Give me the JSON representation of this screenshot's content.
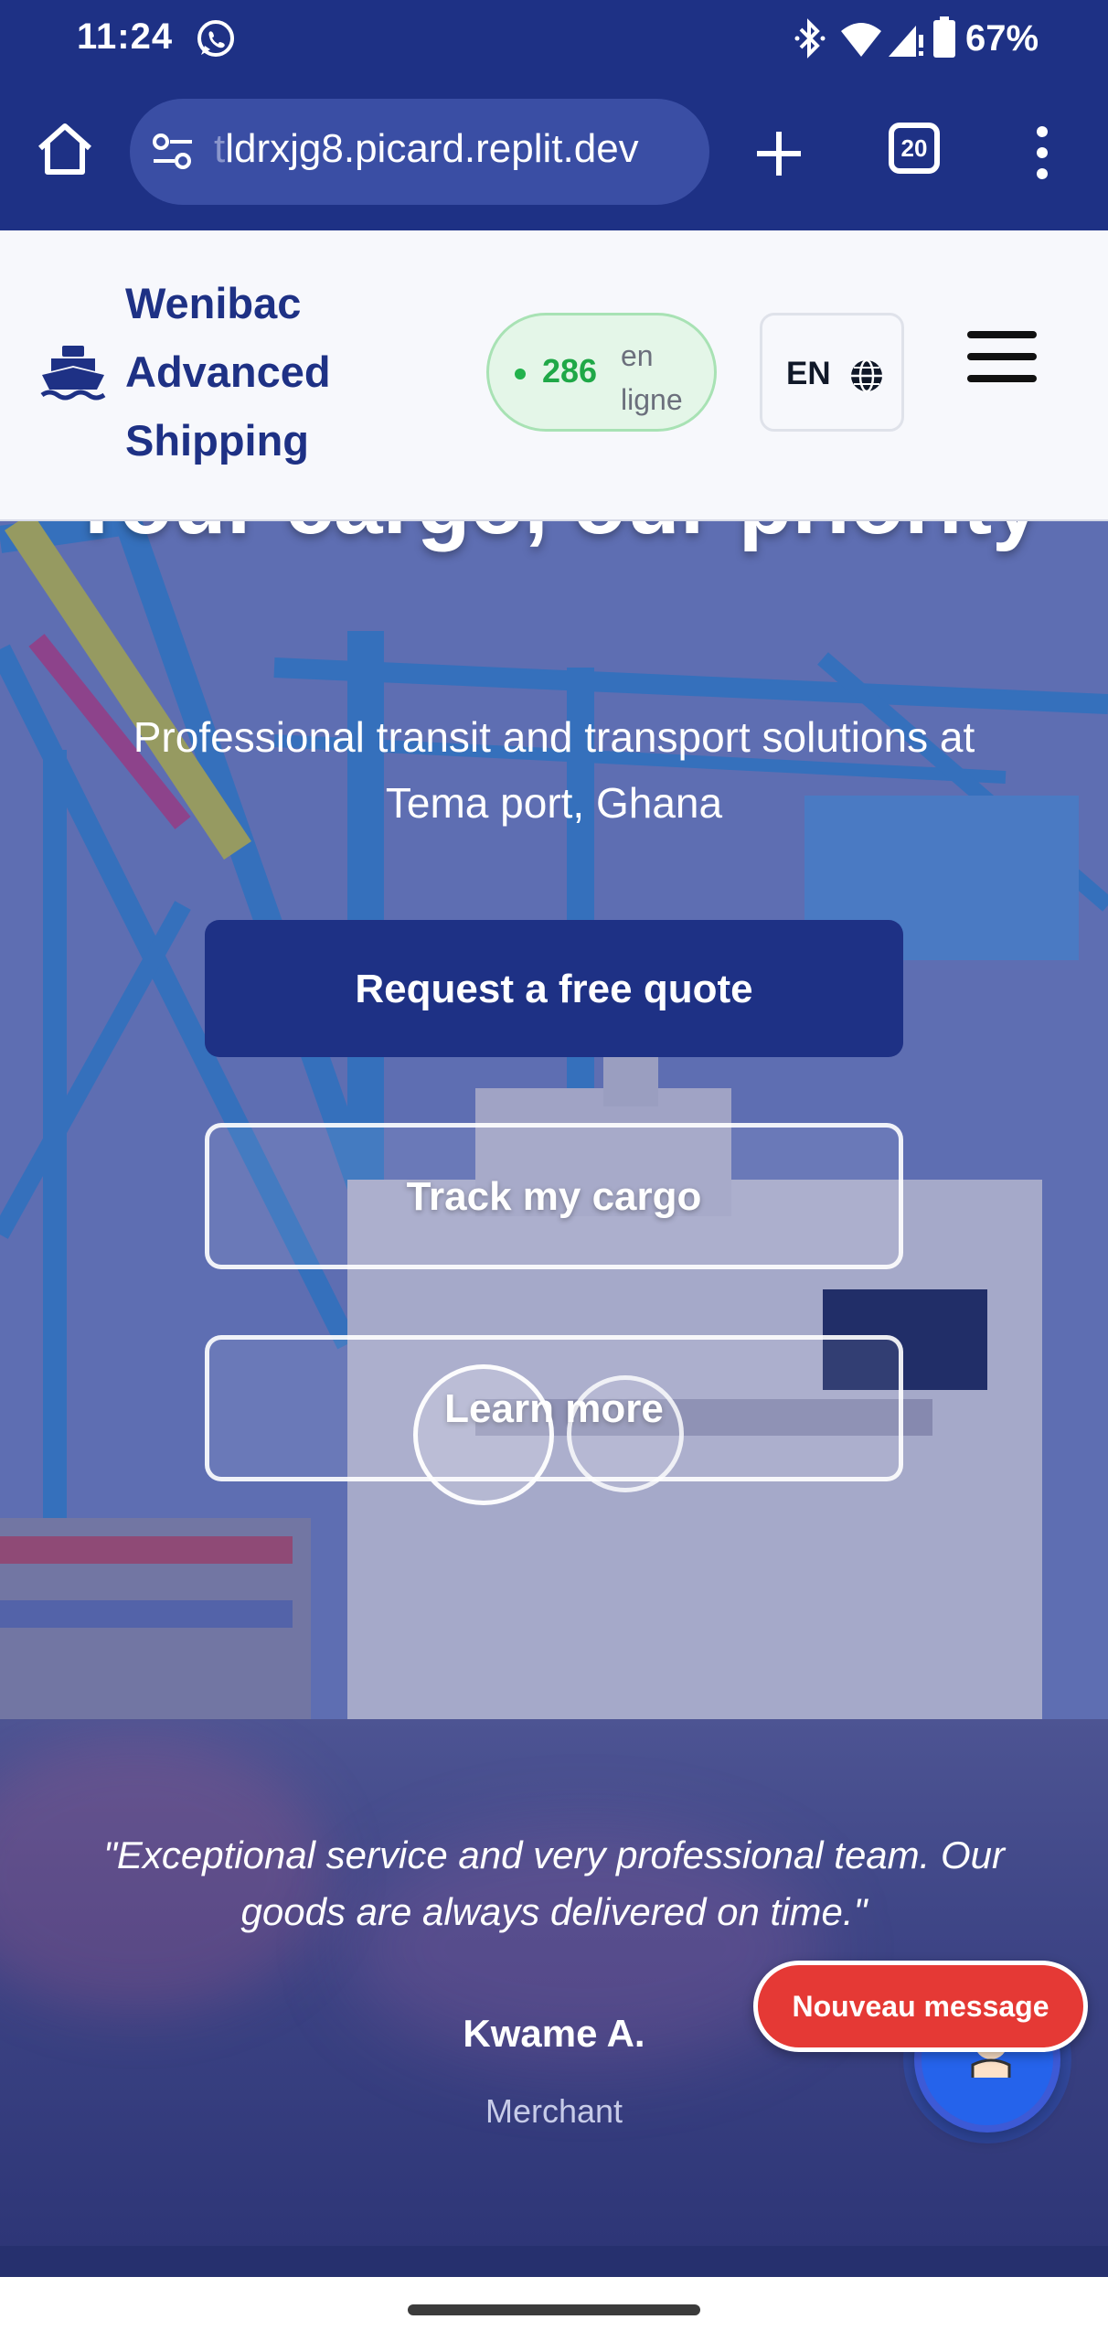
{
  "status_bar": {
    "time": "11:24",
    "battery": "67%",
    "icons": [
      "whatsapp-icon",
      "bluetooth-icon",
      "wifi-icon",
      "cell-signal-icon",
      "battery-icon"
    ]
  },
  "browser": {
    "url_faded": "t",
    "url": "ldrxjg8.picard.replit.dev",
    "tab_count": "20",
    "icons": [
      "home-icon",
      "site-settings-icon",
      "new-tab-icon",
      "tab-switcher-icon",
      "menu-icon"
    ]
  },
  "header": {
    "brand": [
      "Wenibac",
      "Advanced",
      "Shipping"
    ],
    "online_count": "286",
    "online_label": "en ligne",
    "language": "EN",
    "colors": {
      "brand": "#1e3185",
      "online": "#1fa847"
    }
  },
  "hero": {
    "title": "Your cargo, our priority",
    "subtitle": "Professional transit and transport solutions at Tema port, Ghana",
    "buttons": {
      "quote": "Request a free quote",
      "track": "Track my cargo",
      "learn": "Learn more"
    }
  },
  "testimonial": {
    "quote": "\"Exceptional service and very professional team. Our goods are always delivered on time.\"",
    "name": "Kwame A.",
    "role": "Merchant"
  },
  "chat": {
    "toast": "Nouveau message",
    "toast_color": "#e53935"
  }
}
